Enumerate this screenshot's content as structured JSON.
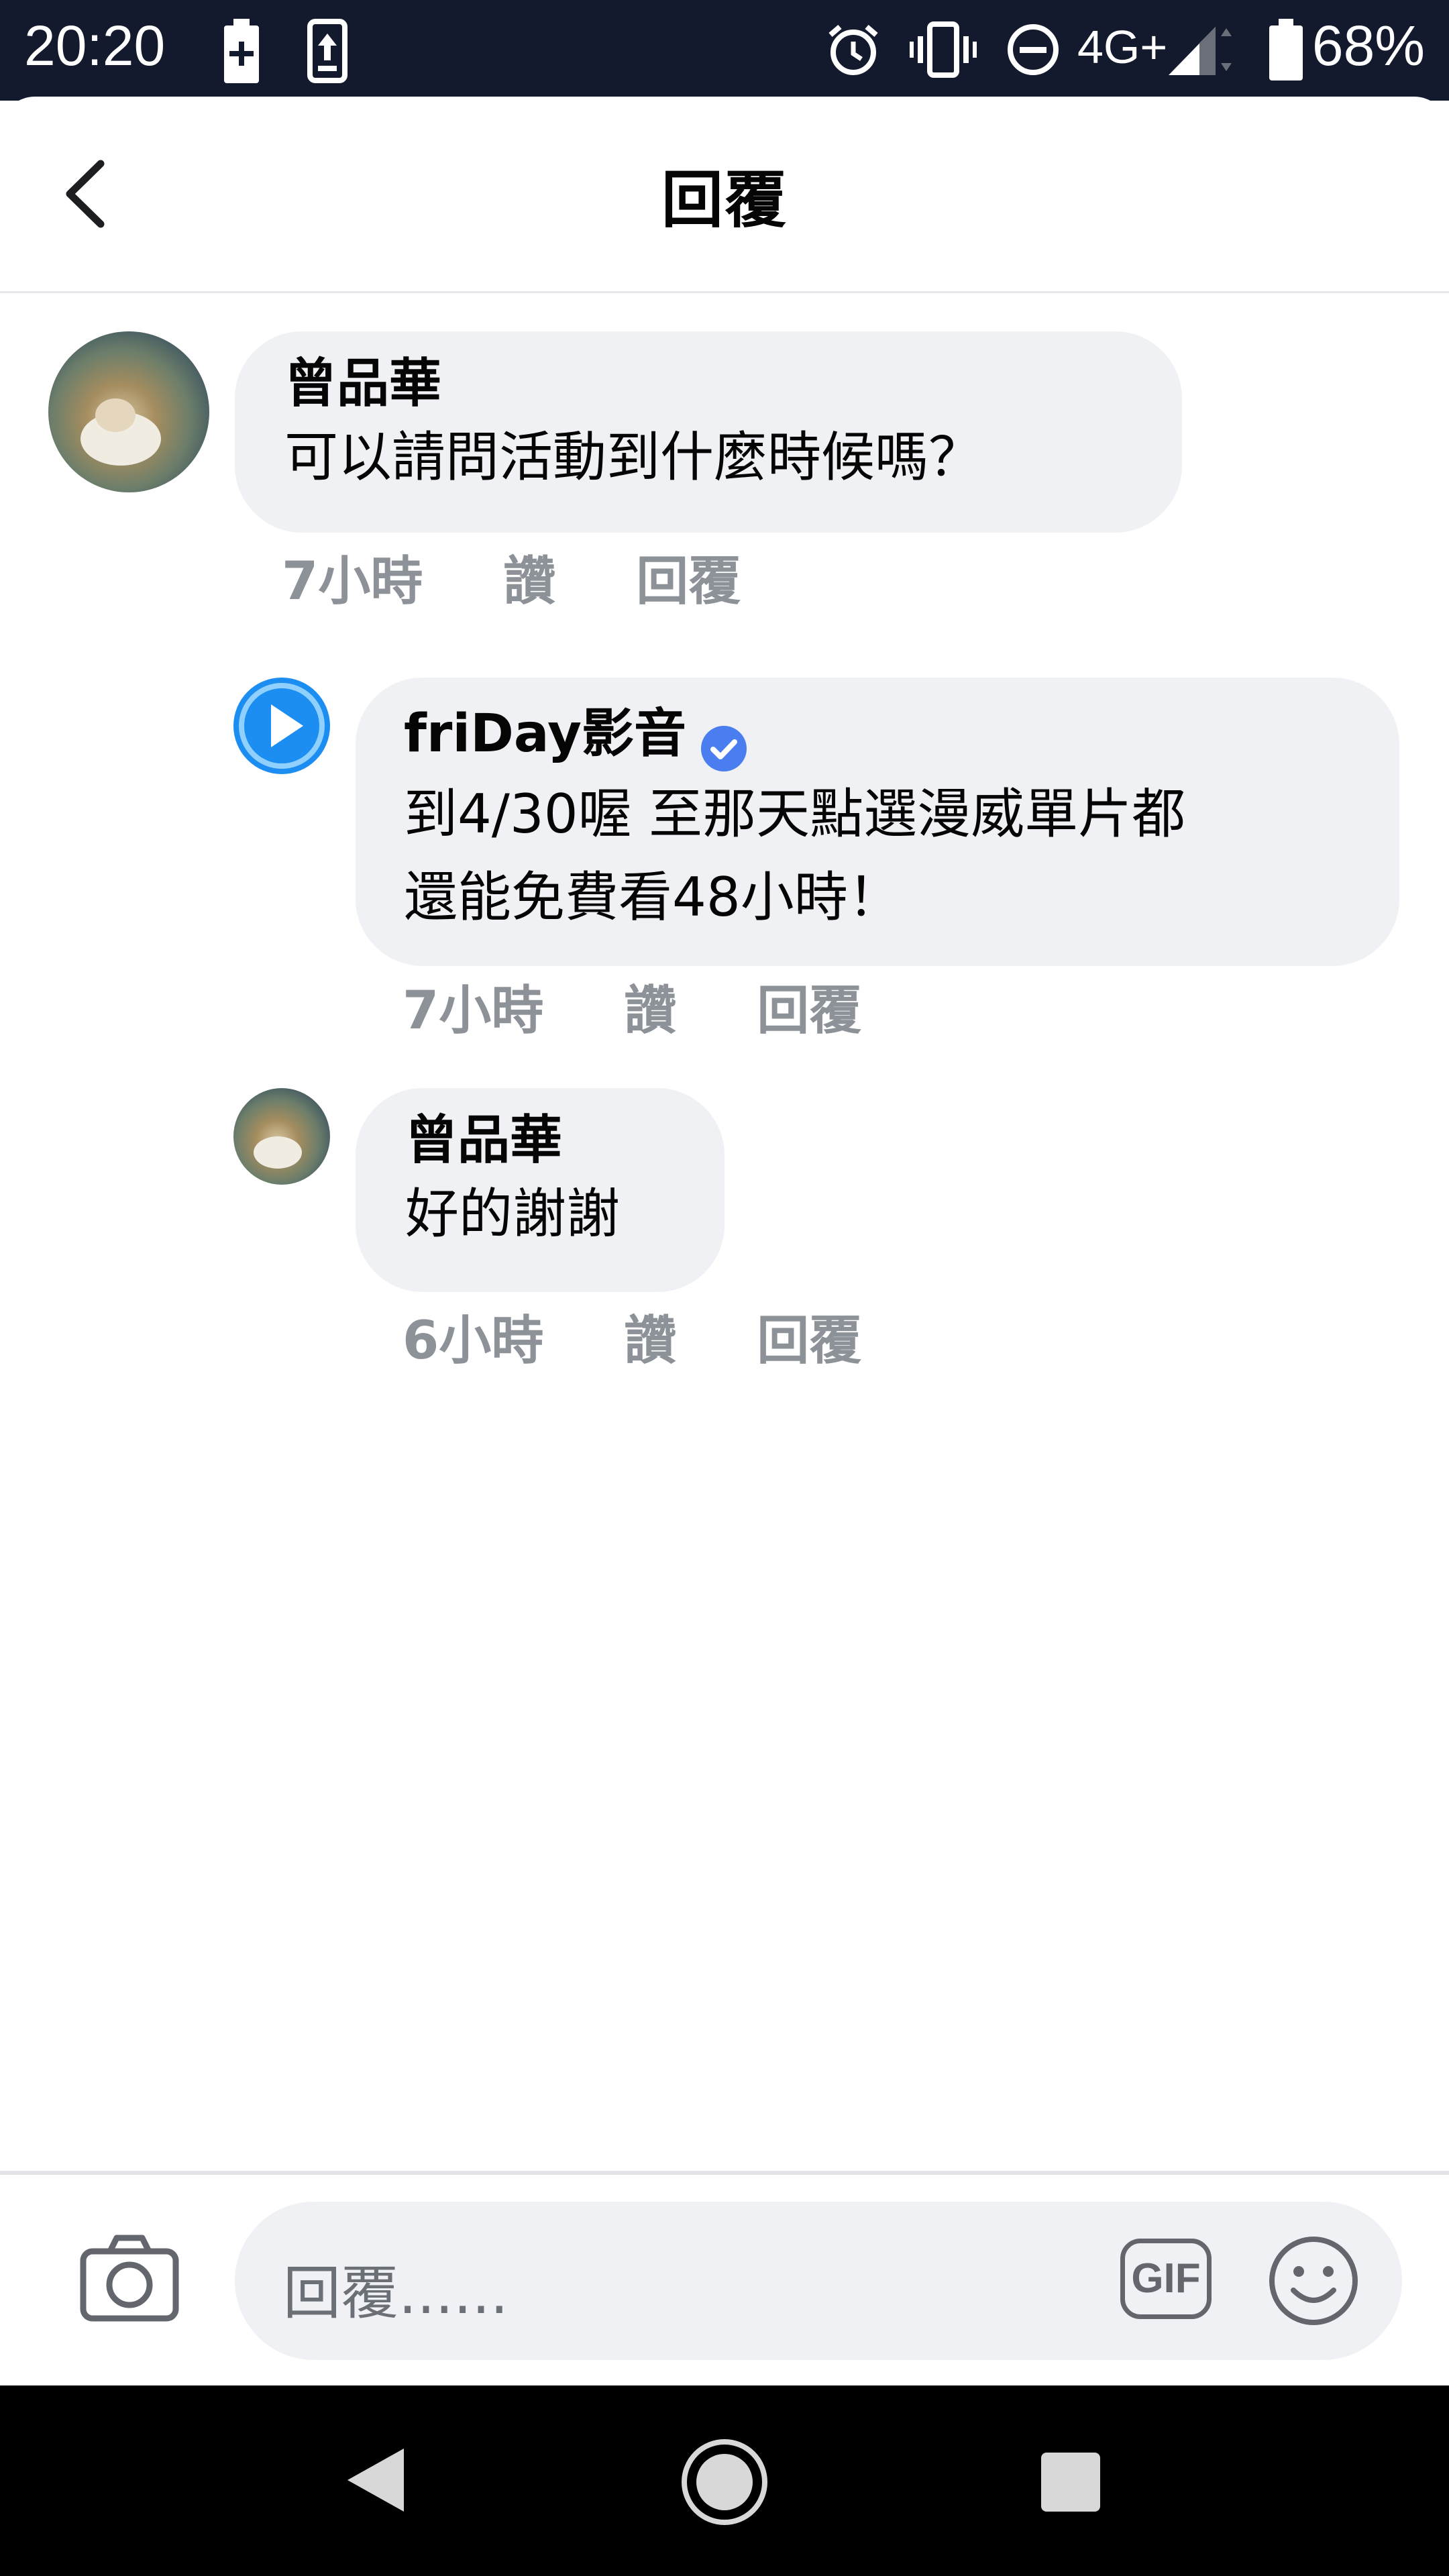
{
  "status_bar": {
    "time": "20:20",
    "network": "4G+",
    "battery_percent": "68%",
    "icons": [
      "battery-saver-icon",
      "upload-icon",
      "alarm-icon",
      "vibrate-icon",
      "dnd-icon",
      "signal-icon",
      "battery-icon"
    ]
  },
  "header": {
    "title": "回覆",
    "back_icon": "chevron-left-icon"
  },
  "comments": [
    {
      "author": "曾品華",
      "text": "可以請問活動到什麼時候嗎？",
      "time": "7小時",
      "like_label": "讚",
      "reply_label": "回覆"
    },
    {
      "author": "friDay影音",
      "verified": true,
      "text_line1": "到4/30喔 至那天點選漫威單片都",
      "text_line2": "還能免費看48小時！",
      "time": "7小時",
      "like_label": "讚",
      "reply_label": "回覆"
    },
    {
      "author": "曾品華",
      "text": "好的謝謝",
      "time": "6小時",
      "like_label": "讚",
      "reply_label": "回覆"
    }
  ],
  "composer": {
    "placeholder": "回覆......",
    "gif_label": "GIF"
  },
  "colors": {
    "status_bar": "#141a2d",
    "bubble": "#f0f1f4",
    "meta_text": "#8d9299",
    "brand_blue": "#1c8ef2",
    "verified_blue": "#4a7ef0"
  }
}
